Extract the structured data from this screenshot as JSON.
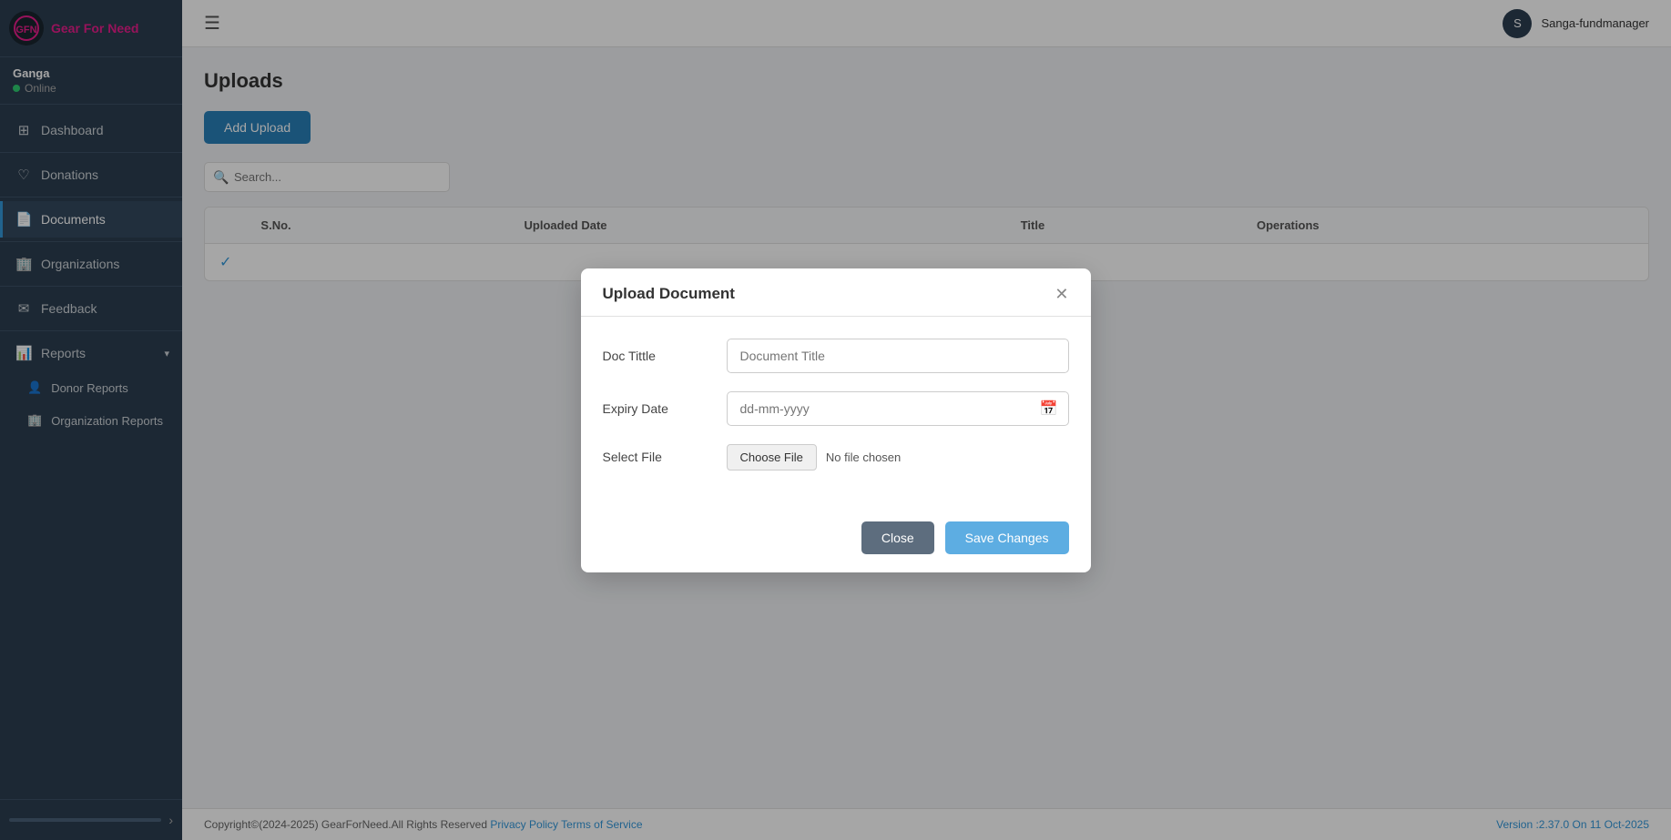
{
  "sidebar": {
    "logo_text": "Gear For Need",
    "username": "Ganga",
    "status": "Online",
    "items": [
      {
        "id": "dashboard",
        "label": "Dashboard",
        "icon": "⊞"
      },
      {
        "id": "donations",
        "label": "Donations",
        "icon": "♡"
      },
      {
        "id": "documents",
        "label": "Documents",
        "icon": "📄"
      },
      {
        "id": "organizations",
        "label": "Organizations",
        "icon": "🏢"
      },
      {
        "id": "feedback",
        "label": "Feedback",
        "icon": "✉"
      },
      {
        "id": "reports",
        "label": "Reports",
        "icon": "📊",
        "hasChevron": true
      }
    ],
    "sub_items": [
      {
        "id": "donor-reports",
        "label": "Donor Reports",
        "icon": "👤"
      },
      {
        "id": "organization-reports",
        "label": "Organization Reports",
        "icon": "🏢"
      }
    ]
  },
  "topbar": {
    "username": "Sanga-fundmanager"
  },
  "page": {
    "title": "Uploads",
    "add_upload_label": "Add Upload"
  },
  "search": {
    "placeholder": "Search..."
  },
  "table": {
    "columns": [
      "S.No.",
      "Uploaded Date",
      "Title",
      "Operations"
    ],
    "rows": []
  },
  "modal": {
    "title": "Upload Document",
    "fields": {
      "doc_title_label": "Doc Tittle",
      "doc_title_placeholder": "Document Title",
      "expiry_date_label": "Expiry Date",
      "expiry_date_placeholder": "dd-mm-yyyy",
      "select_file_label": "Select File",
      "choose_file_label": "Choose File",
      "no_file_text": "No file chosen"
    },
    "close_label": "Close",
    "save_label": "Save Changes"
  },
  "footer": {
    "copyright": "Copyright©(2024-2025) GearForNeed.All Rights Reserved",
    "privacy_policy": "Privacy Policy",
    "terms": "Terms of Service",
    "version": "Version :2.37.0 On 11 Oct-2025"
  }
}
